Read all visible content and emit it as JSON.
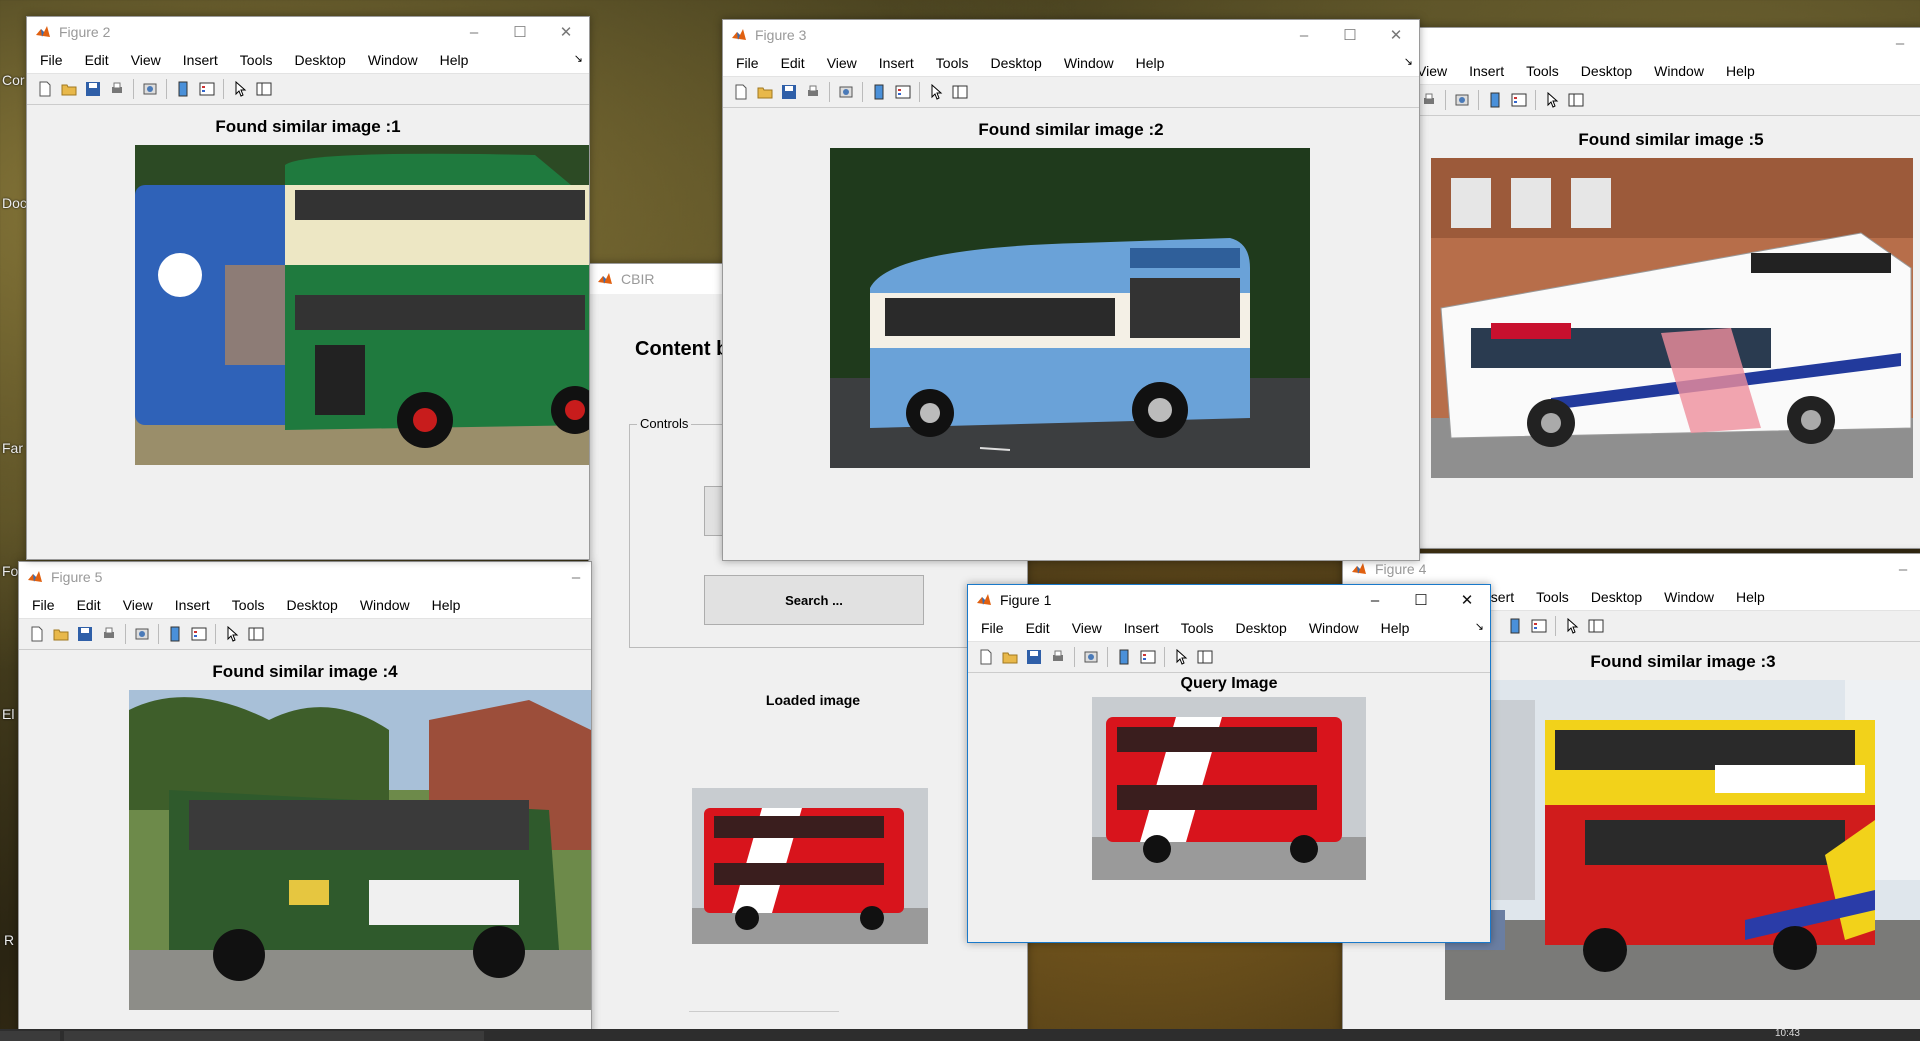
{
  "menus": [
    "File",
    "Edit",
    "View",
    "Insert",
    "Tools",
    "Desktop",
    "Window",
    "Help"
  ],
  "menus_fig4": [
    "nsert",
    "Tools",
    "Desktop",
    "Window",
    "Help"
  ],
  "menus_fig5_partial": [
    "View",
    "Insert",
    "Tools",
    "Desktop",
    "Window",
    "Help"
  ],
  "desktop_labels": [
    "Cor",
    "Doc",
    "Far",
    "Fo",
    "El",
    "R"
  ],
  "windows": {
    "figure2": {
      "title": "Figure 2",
      "heading": "Found similar image :1"
    },
    "figure3": {
      "title": "Figure 3",
      "heading": "Found similar image :2"
    },
    "figure_right": {
      "heading": "Found similar image :5"
    },
    "figure5": {
      "title": "Figure 5",
      "heading": "Found similar image :4"
    },
    "figure4": {
      "title": "Figure 4",
      "heading": "Found similar image :3"
    },
    "figure1": {
      "title": "Figure 1",
      "heading": "Query Image"
    },
    "cbir": {
      "title": "CBIR",
      "heading": "Content b",
      "panel_label": "Controls",
      "search_button": "Search ...",
      "loaded_label": "Loaded image"
    }
  },
  "controls": {
    "minimize": "–",
    "maximize": "☐",
    "close": "✕"
  },
  "taskbar": {
    "time": "10:43"
  },
  "colors": {
    "matlab_orange": "#e06010",
    "active_border": "#1979ca",
    "window_bg": "#f0f0f0"
  }
}
